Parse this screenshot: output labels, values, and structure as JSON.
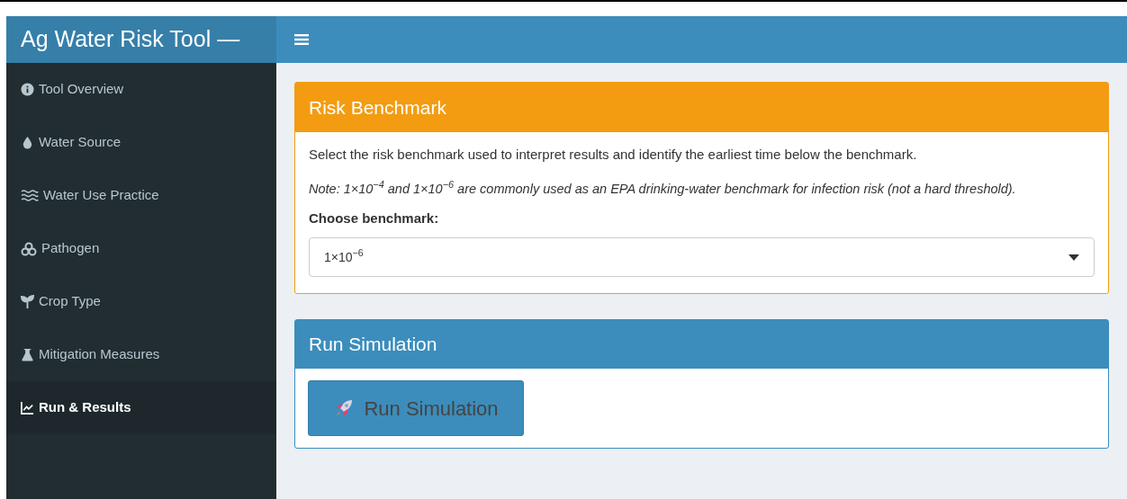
{
  "header": {
    "title": "Ag Water Risk Tool —"
  },
  "sidebar": {
    "items": [
      {
        "label": "Tool Overview",
        "selected": false
      },
      {
        "label": "Water Source",
        "selected": false
      },
      {
        "label": "Water Use Practice",
        "selected": false
      },
      {
        "label": "Pathogen",
        "selected": false
      },
      {
        "label": "Crop Type",
        "selected": false
      },
      {
        "label": "Mitigation Measures",
        "selected": false
      },
      {
        "label": "Run & Results",
        "selected": true
      }
    ]
  },
  "benchmark_box": {
    "title": "Risk Benchmark",
    "description": "Select the risk benchmark used to interpret results and identify the earliest time below the benchmark.",
    "note": "Note: 1×10$^{−4}$ and 1×10$^{−6}$ are commonly used as an EPA drinking-water benchmark for infection risk (not a hard threshold).",
    "select_label": "Choose benchmark:",
    "select_value": "1×10$^{−6}$"
  },
  "simulation_box": {
    "title": "Run Simulation",
    "button": "Run Simulation"
  }
}
